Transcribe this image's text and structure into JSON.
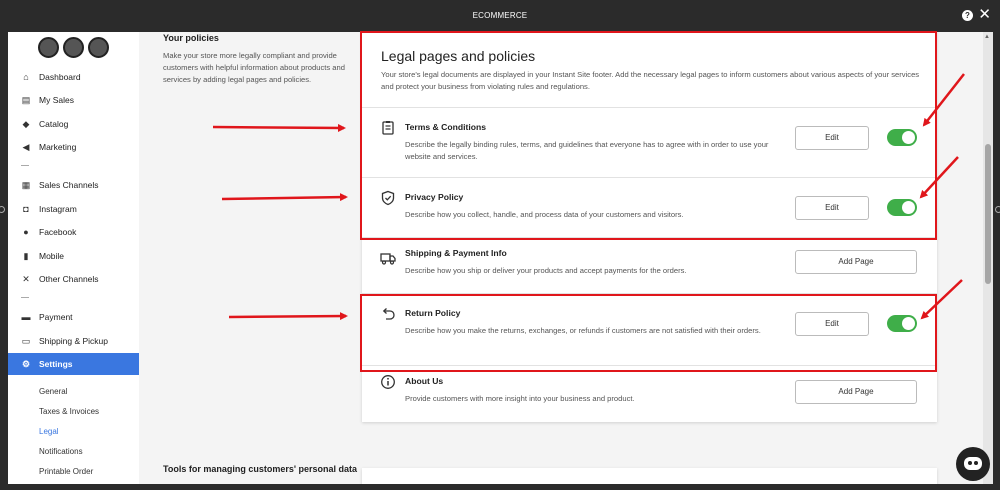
{
  "window": {
    "title": "ECOMMERCE"
  },
  "sidebar": {
    "items": [
      {
        "label": "Dashboard",
        "icon": "home-icon",
        "glyph": "⌂"
      },
      {
        "label": "My Sales",
        "icon": "sales-icon",
        "glyph": "▤"
      },
      {
        "label": "Catalog",
        "icon": "tag-icon",
        "glyph": "◆"
      },
      {
        "label": "Marketing",
        "icon": "megaphone-icon",
        "glyph": "◀"
      },
      {
        "label": "Sales Channels",
        "icon": "channels-icon",
        "glyph": "▦"
      },
      {
        "label": "Instagram",
        "icon": "instagram-icon",
        "glyph": "◘"
      },
      {
        "label": "Facebook",
        "icon": "facebook-icon",
        "glyph": "●"
      },
      {
        "label": "Mobile",
        "icon": "mobile-icon",
        "glyph": "▮"
      },
      {
        "label": "Other Channels",
        "icon": "other-channels-icon",
        "glyph": "✕"
      },
      {
        "label": "Payment",
        "icon": "payment-icon",
        "glyph": "▬"
      },
      {
        "label": "Shipping & Pickup",
        "icon": "truck-icon",
        "glyph": "▭"
      },
      {
        "label": "Settings",
        "icon": "gear-icon",
        "glyph": "⚙"
      }
    ],
    "subitems": [
      "General",
      "Taxes & Invoices",
      "Legal",
      "Notifications",
      "Printable Order"
    ]
  },
  "policies": {
    "title": "Your policies",
    "description": "Make your store more legally compliant and provide customers with helpful information about products and services by adding legal pages and policies."
  },
  "card": {
    "title": "Legal pages and policies",
    "description": "Your store's legal documents are displayed in your Instant Site footer. Add the necessary legal pages to inform customers about various aspects of your services and protect your business from violating rules and regulations.",
    "rows": [
      {
        "title": "Terms & Conditions",
        "description": "Describe the legally binding rules, terms, and guidelines that everyone has to agree with in order to use your website and services.",
        "button": "Edit",
        "enabled": true,
        "icon": "document-icon"
      },
      {
        "title": "Privacy Policy",
        "description": "Describe how you collect, handle, and process data of your customers and visitors.",
        "button": "Edit",
        "enabled": true,
        "icon": "shield-icon"
      },
      {
        "title": "Shipping & Payment Info",
        "description": "Describe how you ship or deliver your products and accept payments for the orders.",
        "button": "Add Page",
        "enabled": false,
        "icon": "truck-icon"
      },
      {
        "title": "Return Policy",
        "description": "Describe how you make the returns, exchanges, or refunds if customers are not satisfied with their orders.",
        "button": "Edit",
        "enabled": true,
        "icon": "return-icon"
      },
      {
        "title": "About Us",
        "description": "Provide customers with more insight into your business and product.",
        "button": "Add Page",
        "enabled": false,
        "icon": "info-icon"
      }
    ]
  },
  "tools": {
    "title": "Tools for managing customers' personal data"
  },
  "colors": {
    "accent": "#3a77e0",
    "toggle_on": "#3fae49",
    "annotation": "#e0161b"
  }
}
